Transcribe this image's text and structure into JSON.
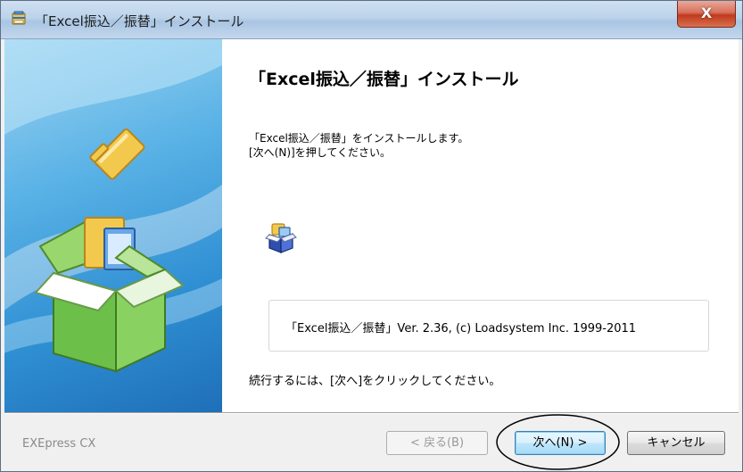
{
  "window": {
    "title": "「Excel振込／振替」インストール",
    "close_label": "X"
  },
  "content": {
    "heading": "「Excel振込／振替」インストール",
    "desc_line1": "「Excel振込／振替」をインストールします。",
    "desc_line2": "[次へ(N)]を押してください。",
    "version_text": "「Excel振込／振替」Ver. 2.36, (c) Loadsystem Inc. 1999-2011",
    "continue_text": "続行するには、[次へ]をクリックしてください。"
  },
  "footer": {
    "brand": "EXEpress CX",
    "back_label": "< 戻る(B)",
    "next_label": "次へ(N) >",
    "cancel_label": "キャンセル"
  },
  "icons": {
    "title": "installer-icon",
    "content": "package-icon",
    "banner": "open-box-with-folder-icon"
  },
  "colors": {
    "title_bar": "#bcd3ea",
    "close_button": "#c03a1e",
    "banner_blue": "#2f8fd3",
    "box_green": "#6cc04a"
  }
}
